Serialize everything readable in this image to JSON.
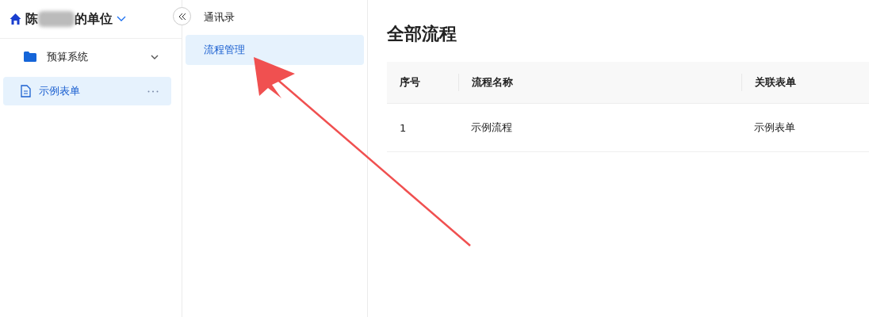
{
  "workspace": {
    "name_start": "陈",
    "name_end": "的单位"
  },
  "sidebar": {
    "items": [
      {
        "kind": "folder",
        "label": "预算系统",
        "expanded": true,
        "selected": false
      },
      {
        "kind": "form",
        "label": "示例表单",
        "selected": true
      }
    ]
  },
  "nav": {
    "items": [
      {
        "label": "通讯录",
        "selected": false
      },
      {
        "label": "流程管理",
        "selected": true
      }
    ]
  },
  "page": {
    "title": "全部流程"
  },
  "table": {
    "columns": [
      "序号",
      "流程名称",
      "关联表单"
    ],
    "rows": [
      [
        "1",
        "示例流程",
        "示例表单"
      ]
    ]
  }
}
